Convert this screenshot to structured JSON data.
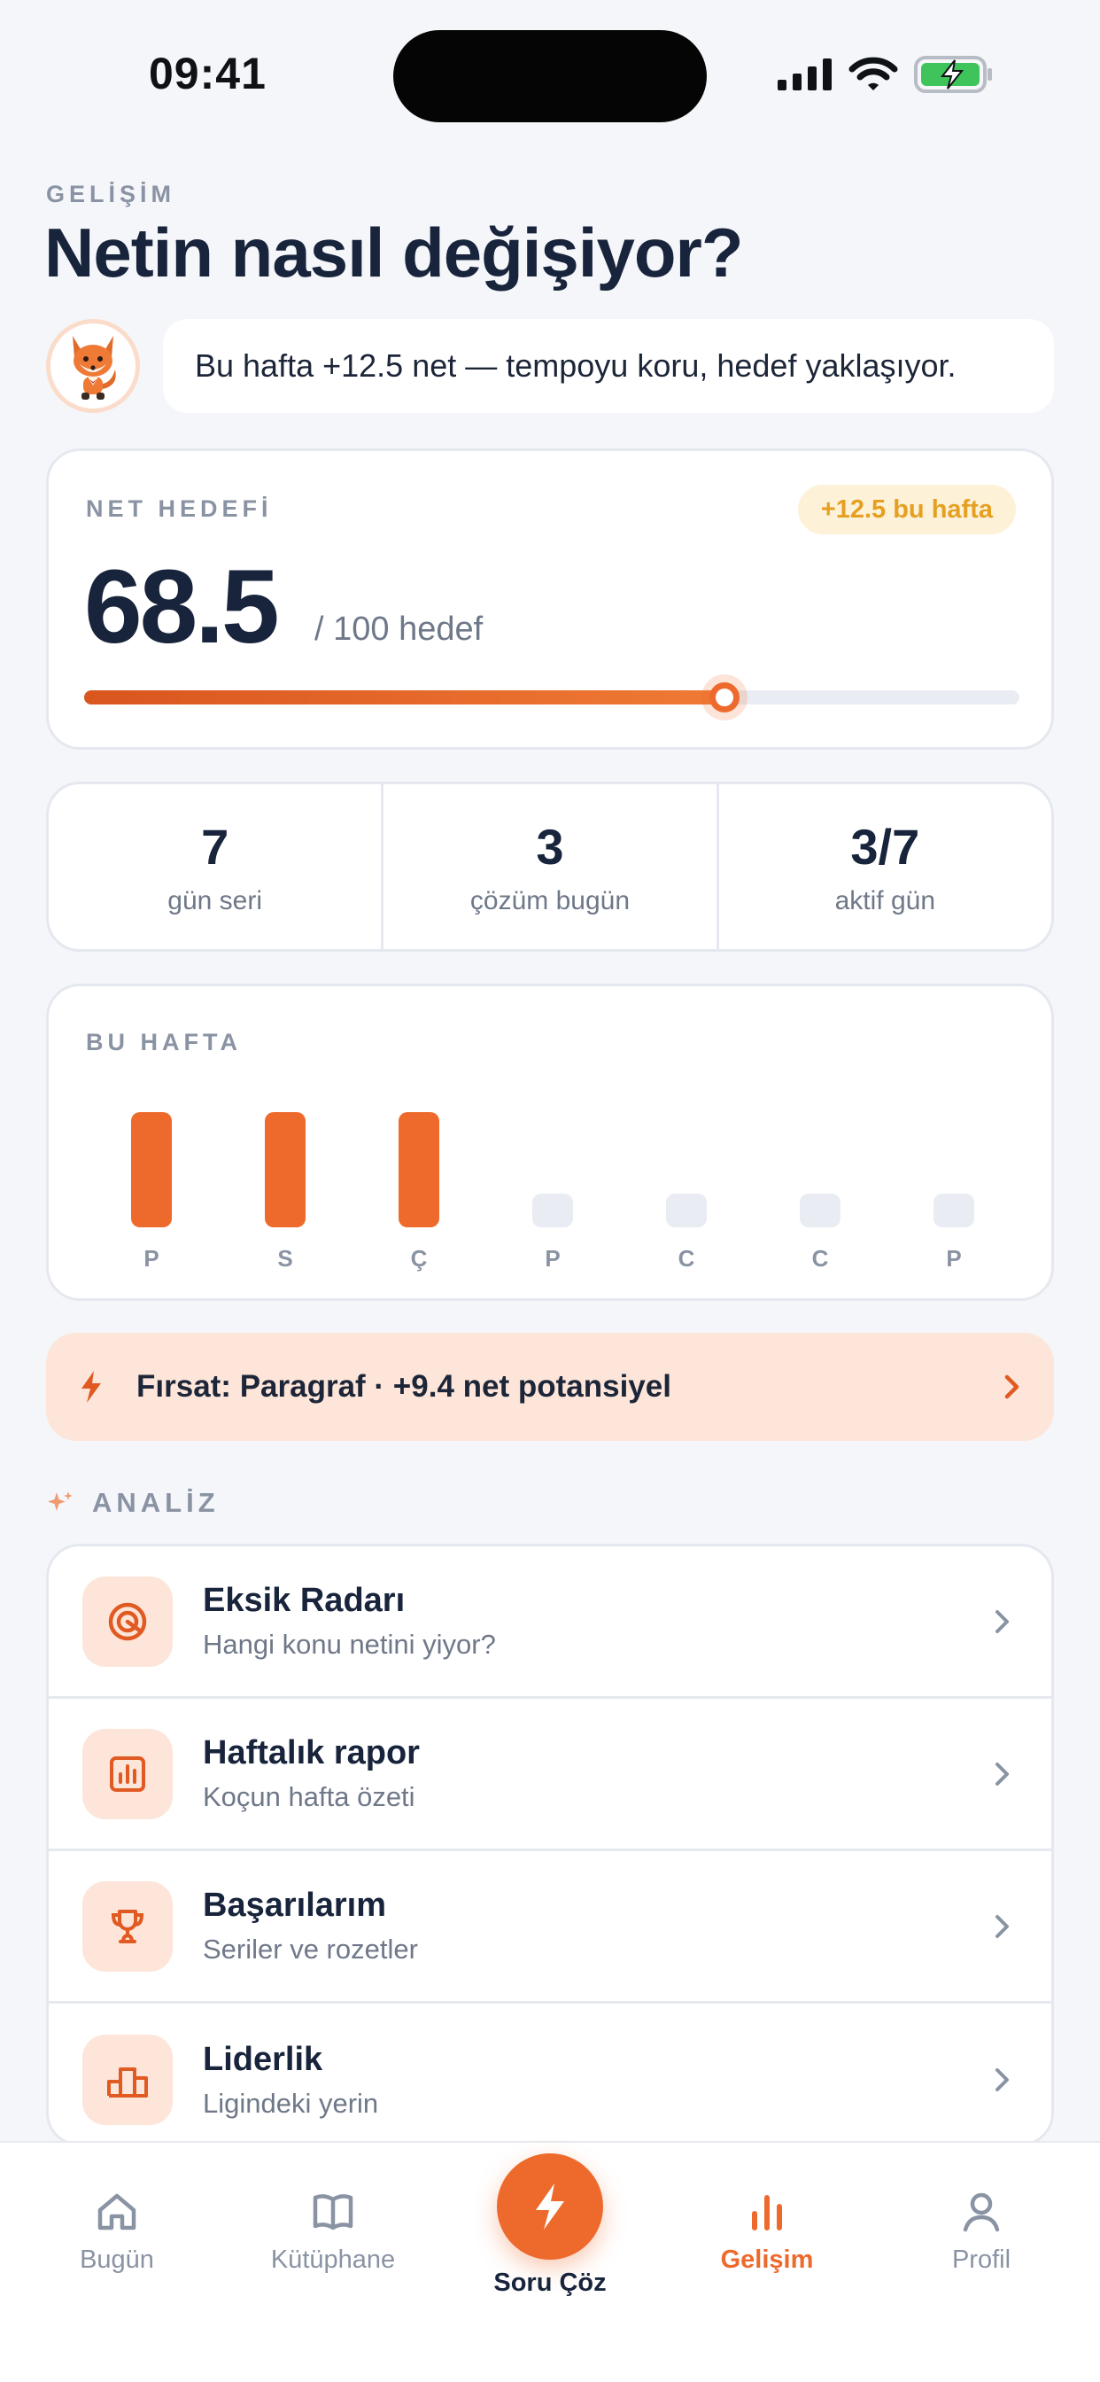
{
  "status_bar": {
    "time": "09:41"
  },
  "header": {
    "eyebrow": "GELİŞİM",
    "title": "Netin nasıl değişiyor?"
  },
  "coach": {
    "message": "Bu hafta +12.5 net — tempoyu koru, hedef yaklaşıyor."
  },
  "goal": {
    "label": "NET HEDEFİ",
    "badge": "+12.5 bu hafta",
    "value": "68.5",
    "target": "/ 100 hedef",
    "progress_percent": 68.5
  },
  "stats": [
    {
      "value": "7",
      "label": "gün seri"
    },
    {
      "value": "3",
      "label": "çözüm bugün"
    },
    {
      "value": "3/7",
      "label": "aktif gün"
    }
  ],
  "week": {
    "label": "BU HAFTA",
    "days": [
      {
        "label": "P",
        "active": true
      },
      {
        "label": "S",
        "active": true
      },
      {
        "label": "Ç",
        "active": true
      },
      {
        "label": "P",
        "active": false
      },
      {
        "label": "C",
        "active": false
      },
      {
        "label": "C",
        "active": false
      },
      {
        "label": "P",
        "active": false
      }
    ]
  },
  "opportunity": {
    "text": "Fırsat: Paragraf · +9.4 net potansiyel"
  },
  "analysis": {
    "label": "ANALİZ",
    "items": [
      {
        "title": "Eksik Radarı",
        "subtitle": "Hangi konu netini yiyor?",
        "icon": "radar-icon"
      },
      {
        "title": "Haftalık rapor",
        "subtitle": "Koçun hafta özeti",
        "icon": "report-icon"
      },
      {
        "title": "Başarılarım",
        "subtitle": "Seriler ve rozetler",
        "icon": "trophy-icon"
      },
      {
        "title": "Liderlik",
        "subtitle": "Ligindeki yerin",
        "icon": "leaderboard-icon"
      }
    ]
  },
  "tabs": [
    {
      "label": "Bugün",
      "icon": "home-icon"
    },
    {
      "label": "Kütüphane",
      "icon": "book-icon"
    },
    {
      "label": "Soru Çöz",
      "icon": "bolt-icon"
    },
    {
      "label": "Gelişim",
      "icon": "chart-icon",
      "active": true
    },
    {
      "label": "Profil",
      "icon": "user-icon"
    }
  ],
  "colors": {
    "accent": "#EE6A2C",
    "accent_soft": "#FDE5D9",
    "badge_text": "#E6A021",
    "ink": "#18243B",
    "muted": "#8A93A3"
  }
}
